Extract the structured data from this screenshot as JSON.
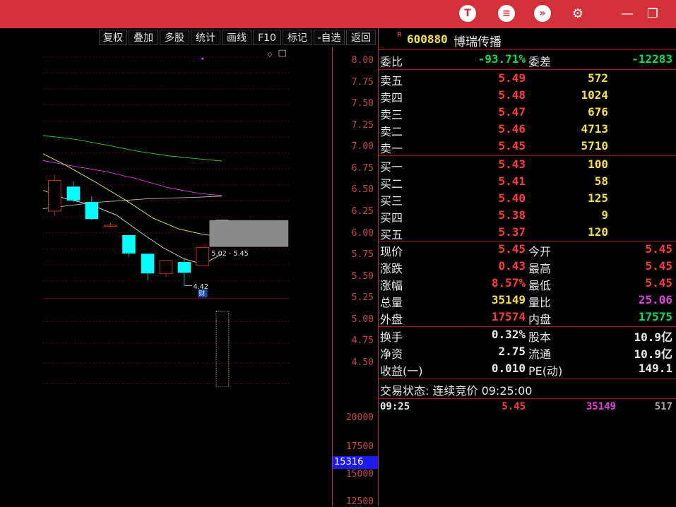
{
  "titlebar": {
    "icons": [
      "shirt-icon",
      "layout-icon",
      "shield-arrow-icon",
      "gear-icon",
      "minimize-icon",
      "restore-icon"
    ]
  },
  "toolbar": {
    "buttons": [
      "复权",
      "叠加",
      "多股",
      "统计",
      "画线",
      "F10",
      "标记",
      "-自选",
      "返回"
    ]
  },
  "chart": {
    "y_ticks": [
      "8.00",
      "7.75",
      "7.50",
      "7.25",
      "7.00",
      "6.75",
      "6.50",
      "6.25",
      "6.00",
      "5.75",
      "5.50",
      "5.25",
      "5.00",
      "4.75",
      "4.50"
    ],
    "vol_ticks": [
      "20000",
      "17500",
      "15000",
      "12500"
    ],
    "vol_current": "15316",
    "range_label": "5.02 - 5.45",
    "low_label": "4.42",
    "fin_badge": "财"
  },
  "chart_data": {
    "type": "candlestick",
    "candles": [
      {
        "open": 5.59,
        "close": 6.07,
        "high": 6.16,
        "low": 5.52
      },
      {
        "open": 5.97,
        "close": 5.76,
        "high": 6.06,
        "low": 5.73
      },
      {
        "open": 5.73,
        "close": 5.47,
        "high": 5.82,
        "low": 5.45
      },
      {
        "open": 5.37,
        "close": 5.37,
        "high": 5.41,
        "low": 5.34
      },
      {
        "open": 5.21,
        "close": 4.93,
        "high": 5.21,
        "low": 4.88
      },
      {
        "open": 4.92,
        "close": 4.62,
        "high": 4.92,
        "low": 4.51
      },
      {
        "open": 4.61,
        "close": 4.82,
        "high": 4.82,
        "low": 4.56
      },
      {
        "open": 4.79,
        "close": 4.63,
        "high": 4.84,
        "low": 4.42
      },
      {
        "open": 4.74,
        "close": 5.02,
        "high": 5.02,
        "low": 4.74
      }
    ],
    "current_bar": {
      "low": 5.02,
      "high": 5.45
    },
    "ylim": [
      4.35,
      8.1
    ]
  },
  "quote": {
    "r_mark": "R",
    "code": "600880",
    "name": "博瑞传播",
    "weibi_label": "委比",
    "weibi": "-93.71%",
    "weicha_label": "委差",
    "weicha": "-12283",
    "sells": [
      {
        "label": "卖五",
        "price": "5.49",
        "vol": "572"
      },
      {
        "label": "卖四",
        "price": "5.48",
        "vol": "1024"
      },
      {
        "label": "卖三",
        "price": "5.47",
        "vol": "676"
      },
      {
        "label": "卖二",
        "price": "5.46",
        "vol": "4713"
      },
      {
        "label": "卖一",
        "price": "5.45",
        "vol": "5710"
      }
    ],
    "buys": [
      {
        "label": "买一",
        "price": "5.43",
        "vol": "100"
      },
      {
        "label": "买二",
        "price": "5.41",
        "vol": "58"
      },
      {
        "label": "买三",
        "price": "5.40",
        "vol": "125"
      },
      {
        "label": "买四",
        "price": "5.38",
        "vol": "9"
      },
      {
        "label": "买五",
        "price": "5.37",
        "vol": "120"
      }
    ],
    "stats": [
      {
        "l1": "现价",
        "v1": "5.45",
        "c1": "red",
        "l2": "今开",
        "v2": "5.45",
        "c2": "red"
      },
      {
        "l1": "涨跌",
        "v1": "0.43",
        "c1": "red",
        "l2": "最高",
        "v2": "5.45",
        "c2": "red"
      },
      {
        "l1": "涨幅",
        "v1": "8.57%",
        "c1": "red",
        "l2": "最低",
        "v2": "5.45",
        "c2": "red"
      },
      {
        "l1": "总量",
        "v1": "35149",
        "c1": "yellow",
        "l2": "量比",
        "v2": "25.06",
        "c2": "magenta"
      },
      {
        "l1": "外盘",
        "v1": "17574",
        "c1": "red",
        "l2": "内盘",
        "v2": "17575",
        "c2": "green"
      }
    ],
    "stats2": [
      {
        "l1": "换手",
        "v1": "0.32%",
        "l2": "股本",
        "v2": "10.9亿"
      },
      {
        "l1": "净资",
        "v1": "2.75",
        "l2": "流通",
        "v2": "10.9亿"
      },
      {
        "l1": "收益(一)",
        "v1": "0.010",
        "l2": "PE(动)",
        "v2": "149.1"
      }
    ],
    "status": "交易状态: 连续竞价 09:25:00",
    "tick": {
      "time": "09:25",
      "price": "5.45",
      "vol": "35149",
      "num": "517"
    }
  },
  "colors": {
    "up": "#ff3c3c",
    "down": "#00ffff",
    "bg": "#000000",
    "title": "#d3313a"
  }
}
